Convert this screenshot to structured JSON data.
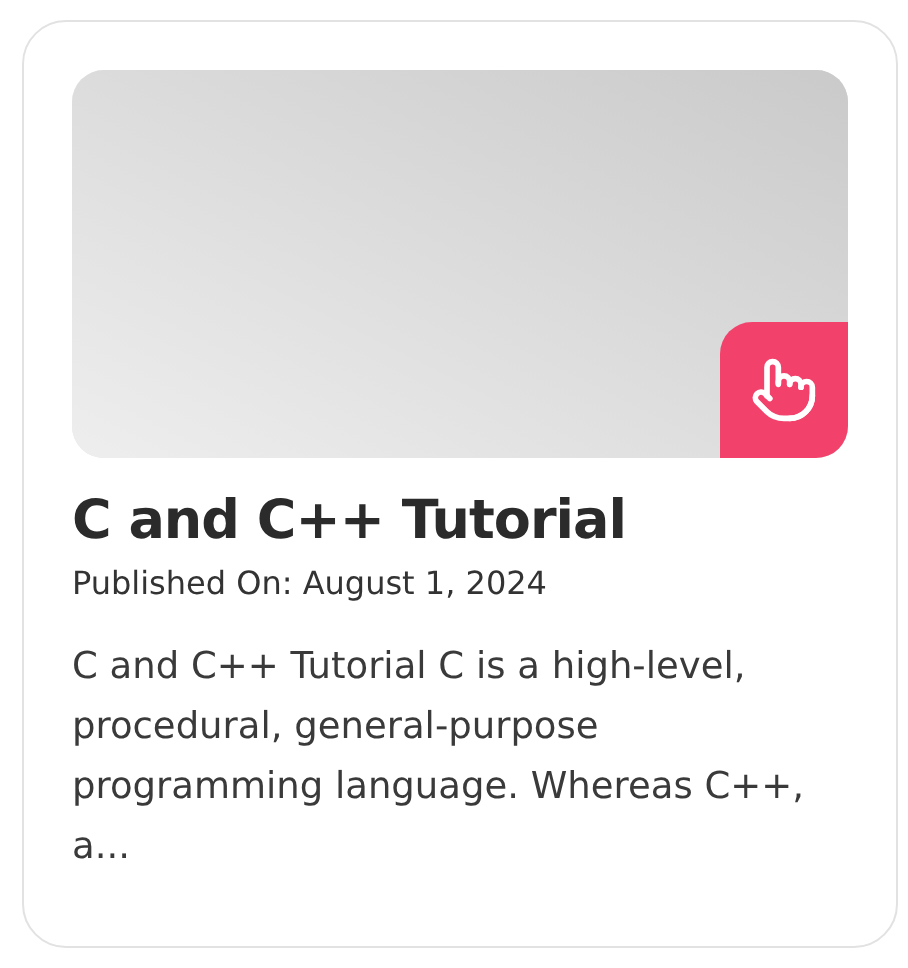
{
  "card": {
    "title": "C and C++ Tutorial",
    "published": "Published On: August 1, 2024",
    "description": "C and C++ Tutorial C is a high-level, procedural, general-purpose programming language. Whereas C++, a..."
  }
}
